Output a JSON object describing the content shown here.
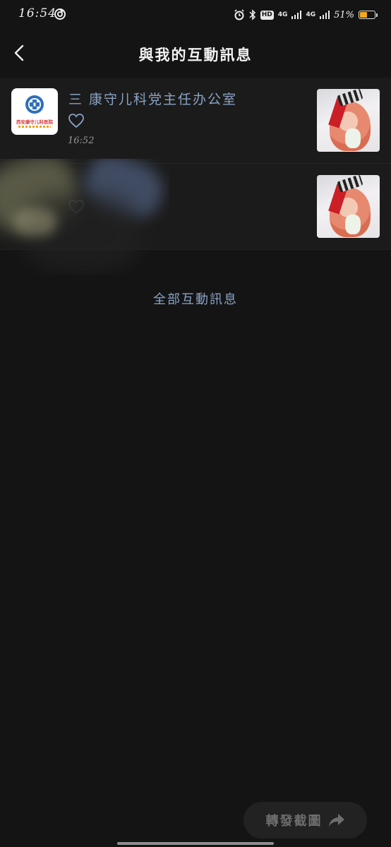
{
  "status_bar": {
    "time": "16:54",
    "hd": "HD",
    "network_1": "4G",
    "network_2": "4G",
    "battery_percent": "51%",
    "battery_level": 0.51,
    "battery_color": "#f2a920"
  },
  "nav": {
    "back_icon": "chevron-left-icon",
    "title": "與我的互動訊息"
  },
  "messages": [
    {
      "sender": "三 康守儿科党主任办公室",
      "avatar_label": "西安康守儿科医院",
      "reaction_icon": "heart-outline-icon",
      "time": "16:52"
    },
    {
      "sender": "",
      "reaction_icon": "heart-outline-icon",
      "time": ""
    }
  ],
  "all_messages_link": "全部互動訊息",
  "share_button": {
    "label": "轉發截圖",
    "icon": "share-arrow-icon"
  },
  "colors": {
    "background": "#141414",
    "row_background": "#1b1b1b",
    "accent_text": "#8aa3c4"
  }
}
